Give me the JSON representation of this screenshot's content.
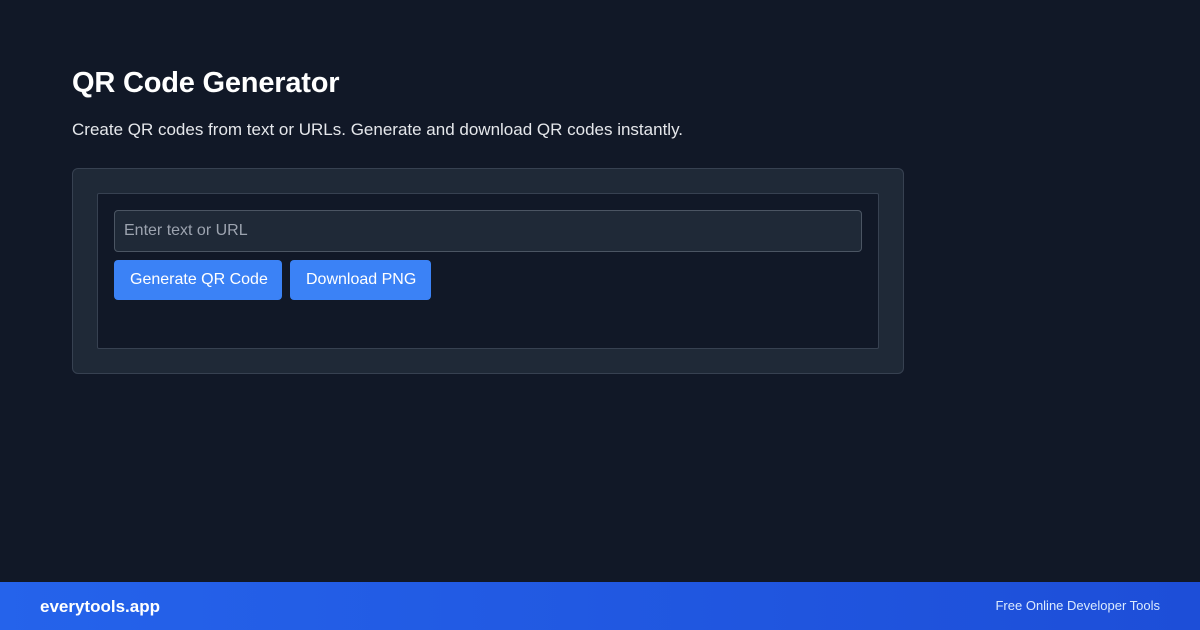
{
  "page": {
    "title": "QR Code Generator",
    "subtitle": "Create QR codes from text or URLs. Generate and download QR codes instantly."
  },
  "form": {
    "input_value": "",
    "input_placeholder": "Enter text or URL",
    "generate_label": "Generate QR Code",
    "download_label": "Download PNG"
  },
  "footer": {
    "brand": "everytools.app",
    "tagline": "Free Online Developer Tools"
  },
  "colors": {
    "background": "#111827",
    "card": "#1f2937",
    "accent": "#3b82f6",
    "footer": "#2563eb"
  }
}
